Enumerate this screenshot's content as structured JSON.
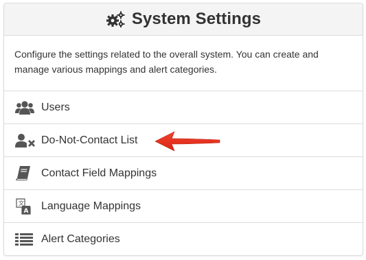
{
  "header": {
    "title": "System Settings",
    "icon": "gears-icon"
  },
  "description": "Configure the settings related to the overall system. You can create and manage various mappings and alert categories.",
  "menu": {
    "items": [
      {
        "label": "Users",
        "icon": "users-icon"
      },
      {
        "label": "Do-Not-Contact List",
        "icon": "user-times-icon"
      },
      {
        "label": "Contact Field Mappings",
        "icon": "book-icon"
      },
      {
        "label": "Language Mappings",
        "icon": "language-icon"
      },
      {
        "label": "Alert Categories",
        "icon": "list-icon"
      }
    ]
  },
  "annotation": {
    "arrow_color": "#e8311e",
    "points_to": "Do-Not-Contact List"
  },
  "colors": {
    "border": "#dcdcdc",
    "header_bg": "#f4f4f4",
    "text": "#333333",
    "icon": "#555555"
  }
}
